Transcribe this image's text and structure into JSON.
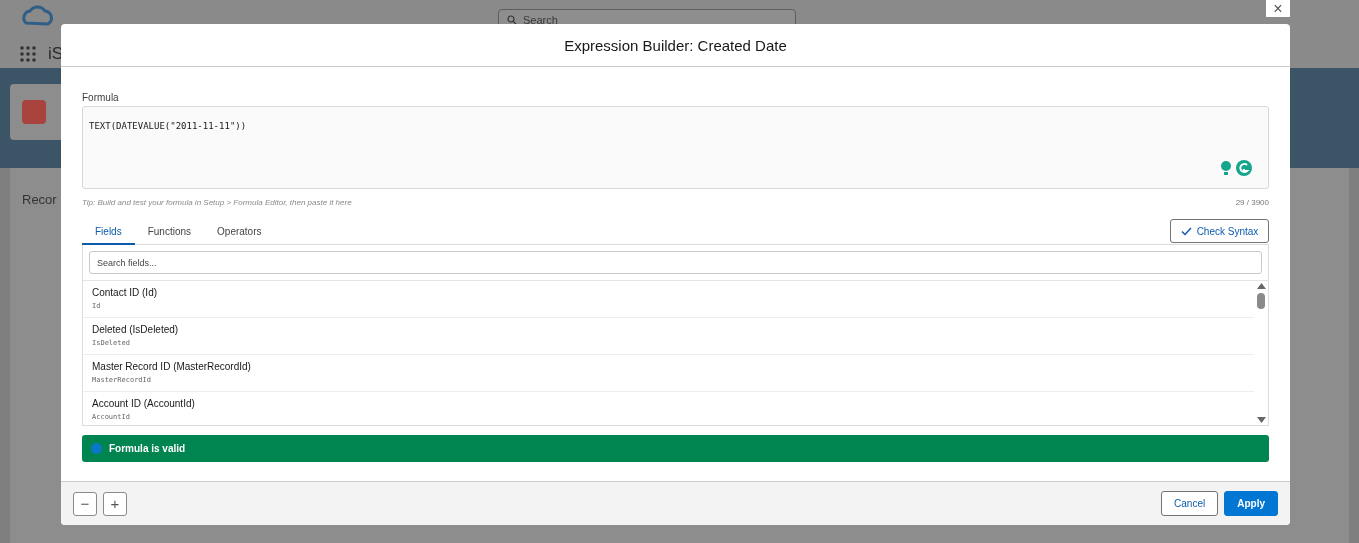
{
  "app": {
    "search_placeholder": "Search",
    "app_name": "iS",
    "tab": "Recor"
  },
  "dialog": {
    "title": "Expression Builder: Created Date",
    "close": "×",
    "formula": {
      "label": "Formula",
      "value": "TEXT(DATEVALUE(\"2011-11-11\"))",
      "tip": "Tip: Build and test your formula in Setup > Formula Editor, then paste it here",
      "count": "29 / 3900"
    },
    "tabs": [
      {
        "label": "Fields",
        "selected": true
      },
      {
        "label": "Functions",
        "selected": false
      },
      {
        "label": "Operators",
        "selected": false
      }
    ],
    "check_syntax": "Check Syntax",
    "search": {
      "placeholder": "Search fields..."
    },
    "fields": [
      {
        "label": "Contact ID (Id)",
        "api_name": "Id"
      },
      {
        "label": "Deleted (IsDeleted)",
        "api_name": "IsDeleted"
      },
      {
        "label": "Master Record ID (MasterRecordId)",
        "api_name": "MasterRecordId"
      },
      {
        "label": "Account ID (AccountId)",
        "api_name": "AccountId"
      }
    ],
    "status": {
      "kind": "valid",
      "text": "Formula is valid"
    },
    "zoom_buttons": [
      "−",
      "+"
    ],
    "buttons": [
      {
        "label": "Cancel",
        "kind": "neutral"
      },
      {
        "label": "Apply",
        "kind": "brand"
      }
    ]
  }
}
